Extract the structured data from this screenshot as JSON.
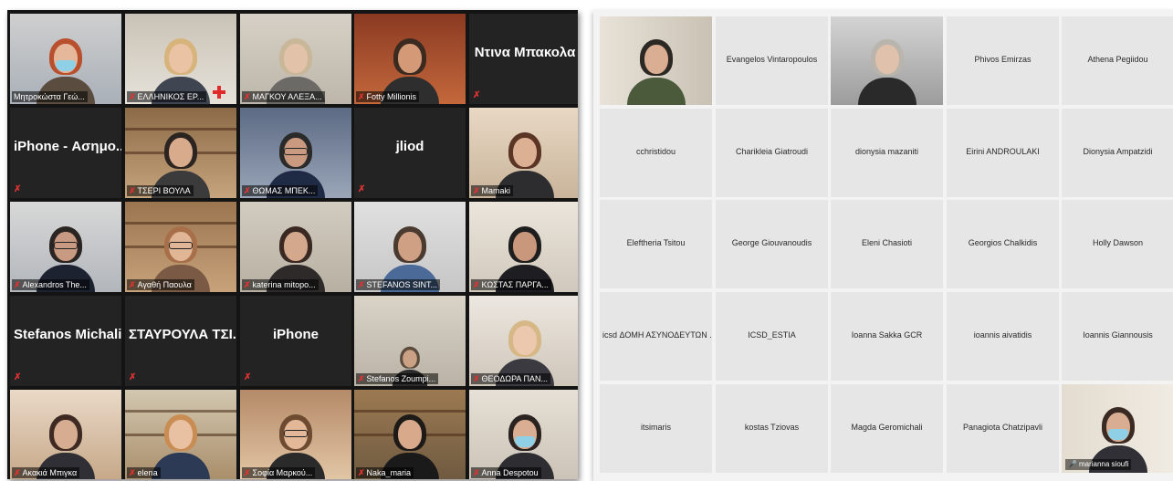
{
  "left_gallery": {
    "tiles": [
      {
        "name": "Μητροκώστα Γεώ...",
        "type": "video",
        "mute": false
      },
      {
        "name": "ΕΛΛΗΝΙΚΟΣ ΕΡ...",
        "type": "video",
        "mute": true
      },
      {
        "name": "ΜΑΓΚΟΥ ΑΛΕΞΑ...",
        "type": "video",
        "mute": true
      },
      {
        "name": "Fotty Millionis",
        "type": "video",
        "mute": true
      },
      {
        "name": "Ντινα Μπακολα",
        "type": "name",
        "mute": true
      },
      {
        "name": "iPhone - Ασημο...",
        "type": "name",
        "mute": true
      },
      {
        "name": "ΤΣΕΡΙ ΒΟΥΛΑ",
        "type": "video",
        "mute": true
      },
      {
        "name": "ΘΩΜΑΣ ΜΠΕΚ...",
        "type": "video",
        "mute": true
      },
      {
        "name": "jliod",
        "type": "name",
        "mute": true
      },
      {
        "name": "Mamaki",
        "type": "video",
        "mute": true
      },
      {
        "name": "Alexandros The...",
        "type": "video",
        "mute": true
      },
      {
        "name": "Αγαθή Παουλα",
        "type": "video",
        "mute": true
      },
      {
        "name": "katerina mitopo...",
        "type": "video",
        "mute": true
      },
      {
        "name": "STEFANOS SINT...",
        "type": "video",
        "mute": true
      },
      {
        "name": "ΚΩΣΤΑΣ ΠΑΡΓΑ...",
        "type": "video",
        "mute": true
      },
      {
        "name": "Stefanos Michalis",
        "type": "name",
        "mute": true
      },
      {
        "name": "ΣΤΑΥΡΟΥΛΑ ΤΣΙ...",
        "type": "name",
        "mute": true
      },
      {
        "name": "iPhone",
        "type": "name",
        "mute": true
      },
      {
        "name": "Stefanos Zoumpi...",
        "type": "video",
        "mute": true
      },
      {
        "name": "ΘΕΟΔΩΡΑ ΠΑΝ...",
        "type": "video",
        "mute": true
      },
      {
        "name": "Ακακιά Μπιγκα",
        "type": "video",
        "mute": true
      },
      {
        "name": "elena",
        "type": "video",
        "mute": true
      },
      {
        "name": "Σοφία Μαρκού...",
        "type": "video",
        "mute": true
      },
      {
        "name": "Naka_maria",
        "type": "video",
        "mute": true
      },
      {
        "name": "Anna Despotou",
        "type": "video",
        "mute": true
      }
    ]
  },
  "right_gallery": {
    "tiles": [
      {
        "name": "",
        "type": "video"
      },
      {
        "name": "Evangelos Vintaropoulos",
        "type": "name"
      },
      {
        "name": "",
        "type": "video"
      },
      {
        "name": "Phivos Emirzas",
        "type": "name"
      },
      {
        "name": "Athena Pegiidou",
        "type": "name"
      },
      {
        "name": "cchristidou",
        "type": "name"
      },
      {
        "name": "Charikleia Giatroudi",
        "type": "name"
      },
      {
        "name": "dionysia mazaniti",
        "type": "name"
      },
      {
        "name": "Eirini ANDROULAKI",
        "type": "name"
      },
      {
        "name": "Dionysia Ampatzidi",
        "type": "name"
      },
      {
        "name": "Eleftheria Tsitou",
        "type": "name"
      },
      {
        "name": "George Giouvanoudis",
        "type": "name"
      },
      {
        "name": "Eleni Chasioti",
        "type": "name"
      },
      {
        "name": "Georgios Chalkidis",
        "type": "name"
      },
      {
        "name": "Holly Dawson",
        "type": "name"
      },
      {
        "name": "icsd ΔΟΜΗ ΑΣΥΝΟΔΕΥΤΩΝ ...",
        "type": "name"
      },
      {
        "name": "ICSD_ESTIA",
        "type": "name"
      },
      {
        "name": "Ioanna Sakka GCR",
        "type": "name"
      },
      {
        "name": "ioannis aivatidis",
        "type": "name"
      },
      {
        "name": "Ioannis Giannousis",
        "type": "name"
      },
      {
        "name": "itsimaris",
        "type": "name"
      },
      {
        "name": "kostas Tziovas",
        "type": "name"
      },
      {
        "name": "Magda Geromichali",
        "type": "name"
      },
      {
        "name": "Panagiota Chatzipavli",
        "type": "name"
      },
      {
        "name": "marianna sioufi",
        "type": "video"
      }
    ]
  },
  "icons": {
    "muted": "muted-mic-icon",
    "mic": "mic-icon"
  },
  "colors": {
    "active_speaker_left": "#b9d64a",
    "active_speaker_right": "#5ec3e8",
    "muted": "#e03232"
  }
}
